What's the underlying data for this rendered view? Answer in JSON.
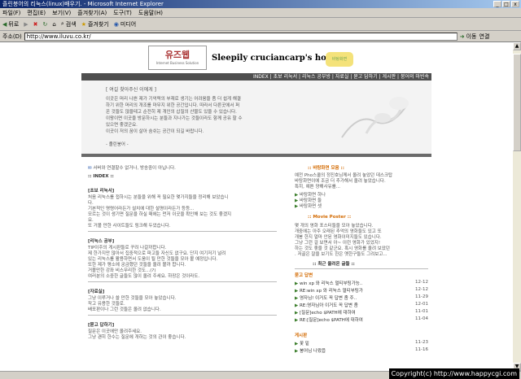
{
  "window": {
    "title": "졸린붕어의 리눅스(linux)배우기. - Microsoft Internet Explorer",
    "btn_min": "_",
    "btn_max": "□",
    "btn_close": "x"
  },
  "menu": [
    "파일(F)",
    "편집(E)",
    "보기(V)",
    "즐겨찾기(A)",
    "도구(T)",
    "도움말(H)"
  ],
  "toolbar": {
    "back": "뒤로",
    "search": "검색",
    "favorites": "즐겨찾기",
    "media": "미디어"
  },
  "address": {
    "label": "주소(D)",
    "url": "http://www.iluvu.co.kr/",
    "go": "이동",
    "links": "연결"
  },
  "site": {
    "logo_main": "유즈웹",
    "logo_sub": "Internet Business Solution",
    "title": "Sleepily cruciancarp's home",
    "badge": "바탕화면",
    "nav": "INDEX | 초보 리눅서 | 리눅스 공부방 | 자료실 | 묻고 답하기 | 게시판 | 붕어의 마빈속"
  },
  "intro": {
    "title": "[ 여길 찾아주신 이에게 ]",
    "lines": [
      "이곳은 머리 나쁜 제가 기억력의 부재로 생기는 어려움을 좀 더 쉽게 해결",
      "하기 위한 머리의 개조를 마무지 위한 공간입니다. 따라서 다른곳에서 퍼",
      "온 것들도 많을테고 순전히 제 개인의 삽질의 산물도 있을 수 있습니다.",
      "이왕이면 이곳을 방문하시는 분들과 지나가는 것들이라도 함께 공유 할 수",
      "있으면 좋겠군요.",
      "이곳이 저의 꿈이 살아 숨쉬는 공간이 되길 바랍니다."
    ],
    "sign": "- 졸린붕어 -"
  },
  "left": {
    "notice": "서버와 연결할수 없거나, 방송중이 아닙니다.",
    "index_title": ":: INDEX ::",
    "sections": [
      {
        "title": "[초보 리눅서]",
        "lines": [
          "처음 리눅스를 접하시는 분들을 위해 꼭 필요한 몇가지들을 정리해 보았습니",
          "다.",
          "기본적인 명령어라든가 설치에 대한 설명이라든가 등등...",
          "모르는 것이 생기면 질문을 하실 때에는 먼저 이곳을 확인해 보는 것도 좋겠지",
          "요.",
          "또 거볼 만한 사이트들도 링크해 두었습니다."
        ]
      },
      {
        "title": "[리눅스 공부]",
        "lines": [
          "TIP이주의 게시판들로 꾸려 나갈까합니다.",
          "제 한가지만 많아서 집중적으로 파고들 자신도 없구요. 단지 여기저기 널려",
          "있는 리눅스를 활용하면서 도움이 될 만한 것들을 모아 볼 예정입니다.",
          "또한 제가 평소에 궁금했던 것들을 올려 볼까 합니다.",
          "거볼만한 강좌 비스무리한 것도...(?)",
          "여러분의 소중한 글들도 많이 올려 주세요. 하장은 것이라도."
        ]
      },
      {
        "title": "[자료실]",
        "lines": [
          "그냥 이루거나 쓸 만한 것들을 모아 놓았습니다.",
          "작고 유용한 것들로.",
          "배포판이나 그런 것들은 올려 없습니다."
        ]
      },
      {
        "title": "[묻고 답하기]",
        "lines": [
          "질문은 이곳에만 올려주세요.",
          "그냥 괜히 한수는 질문에 개하는 것의 관이 좋습니다."
        ]
      }
    ]
  },
  "right": {
    "wallpaper_title": ":: 바탕화면 모음 ::",
    "wallpaper_lines": [
      "예전 Pho스쿨의 정진호님께서 올려 놓았던 데스크탑",
      "바탕화면이에 조금 더 추가해서 올려 놓았습니다.",
      "특히, 예쁜 양해사유를..."
    ],
    "wallpaper_links": [
      "바탕화면 하나",
      "바탕화면 둘",
      "바탕화면 셋"
    ],
    "movie_title": ":: Movie Poster ::",
    "movie_lines": [
      "몇 개의 영화 포스터들을 모아 놓았습니다.",
      "개중에는 아주 오래된 추억의 영화들도 있고 또",
      "개봉 한지 얼마 안된 영화이미지들도 있습니다.",
      "그냥 그런 걸 보면서 아~ 이런 영화가 있었지!",
      "하는 것도 좋을 것 같군요. 혹시 영화를 올려 보았던",
      ". 저골은 잘을 보기도 한은 옛한구들도 그려보고..."
    ],
    "recent_title": ":: 최근 올려온 글들 ::",
    "qa_title": "묻고 답변",
    "qa_items": [
      {
        "text": "win xp 와 리눅스 멀티부팅가능..",
        "date": "12-12"
      },
      {
        "text": "RE:win xp 와 리눅스 멀티부팅가",
        "date": "12-12"
      },
      {
        "text": "영자님! 이거도 꼭 답변 좀 주..",
        "date": "11-29"
      },
      {
        "text": "RE:영자님아 이거도 꼭 답변 좀",
        "date": "12-01"
      },
      {
        "text": "[질문]echo $PATH에 대하여",
        "date": "11-01"
      },
      {
        "text": "RE:[질문]echo $PATH에 대하여",
        "date": "11-04"
      }
    ],
    "board_title": "게시판",
    "board_items": [
      {
        "text": "꽃 밑",
        "date": "11-23"
      },
      {
        "text": "붕어님 나왔읍",
        "date": "11-16"
      }
    ]
  },
  "watermark": "Copyright(c) http://www.happycgi.com"
}
